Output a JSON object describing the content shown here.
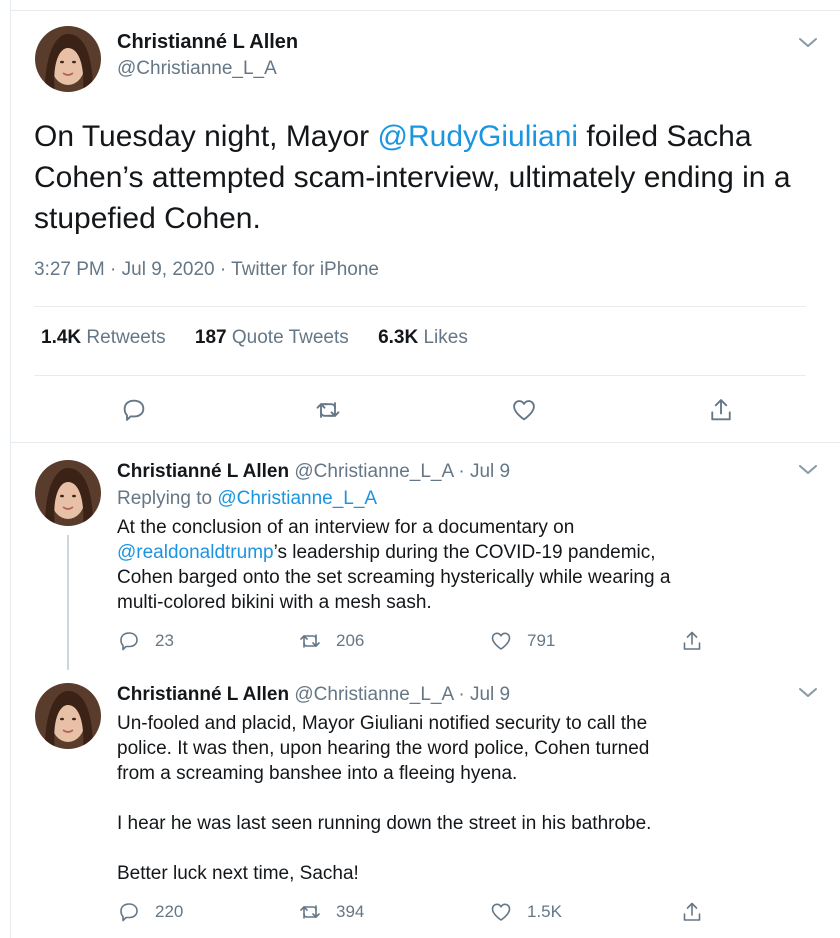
{
  "main_tweet": {
    "name": "Christianné L Allen",
    "handle": "@Christianne_L_A",
    "text_pre": "On Tuesday night, Mayor ",
    "mention": "@RudyGiuliani",
    "text_post": " foiled Sacha Cohen’s attempted scam-interview, ultimately ending in a stupefied Cohen.",
    "timestamp": "3:27 PM · Jul 9, 2020 · Twitter for iPhone",
    "stats": {
      "retweets_count": "1.4K",
      "retweets_label": "Retweets",
      "quotes_count": "187",
      "quotes_label": "Quote Tweets",
      "likes_count": "6.3K",
      "likes_label": "Likes"
    },
    "actions": [
      "reply-icon",
      "retweet-icon",
      "like-icon",
      "share-icon"
    ]
  },
  "reply_1": {
    "name": "Christianné L Allen",
    "handle_date": "@Christianne_L_A · Jul 9",
    "replying_prefix": "Replying to ",
    "replying_to": "@Christianne_L_A",
    "line1": "At the conclusion of an interview for a documentary on",
    "mention": "@realdonaldtrump",
    "line2_rest": "’s leadership during the COVID-19 pandemic,",
    "line3": "Cohen barged onto the set screaming hysterically while wearing a",
    "line4": "multi-colored bikini with a mesh sash.",
    "reply_count": "23",
    "retweet_count": "206",
    "like_count": "791"
  },
  "reply_2": {
    "name": "Christianné L Allen",
    "handle_date": "@Christianne_L_A · Jul 9",
    "line1": "Un-fooled and placid, Mayor Giuliani notified security to call the",
    "line2": "police. It was then, upon hearing the word police, Cohen turned",
    "line3": "from a screaming banshee into a fleeing hyena.",
    "para2": "I hear he was last seen running down the street in his bathrobe.",
    "para3": "Better luck next time, Sacha!",
    "reply_count": "220",
    "retweet_count": "394",
    "like_count": "1.5K"
  },
  "colors": {
    "accent": "#1b95e0",
    "secondary_text": "#657786",
    "primary_text": "#14171a",
    "divider": "#e6ecf0"
  }
}
